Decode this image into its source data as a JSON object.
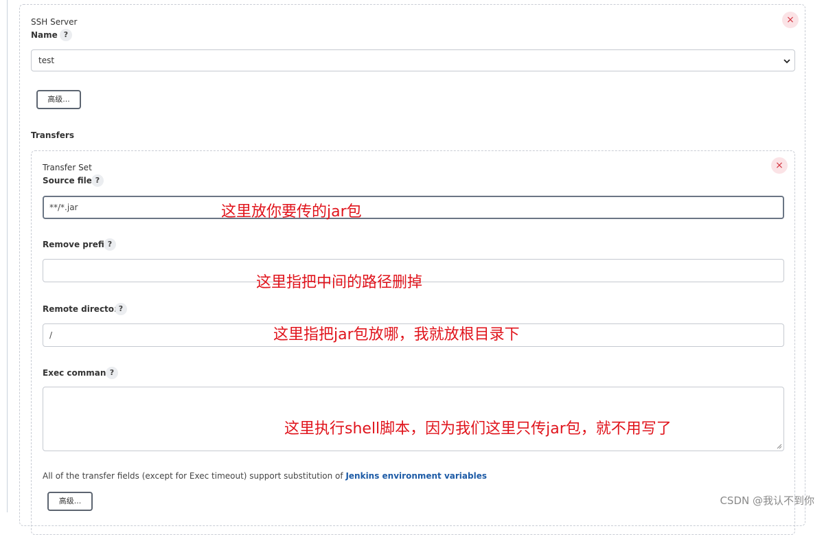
{
  "ssh_server": {
    "section_title": "SSH Server",
    "name_label": "Name",
    "help": "?",
    "close": "×",
    "selected_value": "test",
    "advanced_button": "高级..."
  },
  "transfers": {
    "label": "Transfers",
    "transfer_set": {
      "section_title": "Transfer Set",
      "close": "×",
      "source_files": {
        "label": "Source files",
        "value": "**/*.jar",
        "help": "?"
      },
      "remove_prefix": {
        "label": "Remove prefix",
        "value": "",
        "help": "?"
      },
      "remote_directory": {
        "label": "Remote directory",
        "value": "/",
        "help": "?"
      },
      "exec_command": {
        "label": "Exec command",
        "value": "",
        "help": "?"
      },
      "note_text": "All of the transfer fields (except for Exec timeout) support substitution of ",
      "note_link": "Jenkins environment variables",
      "advanced_button": "高级..."
    }
  },
  "annotations": {
    "source": "这里放你要传的jar包",
    "prefix": "这里指把中间的路径删掉",
    "remote": "这里指把jar包放哪，我就放根目录下",
    "exec": "这里执行shell脚本，因为我们这里只传jar包，就不用写了"
  },
  "watermark": "CSDN @我认不到你",
  "colors": {
    "annotation": "#e0141c",
    "link": "#1d5ba6",
    "close_bg": "#fbe3e6",
    "close_fg": "#d2343f"
  }
}
